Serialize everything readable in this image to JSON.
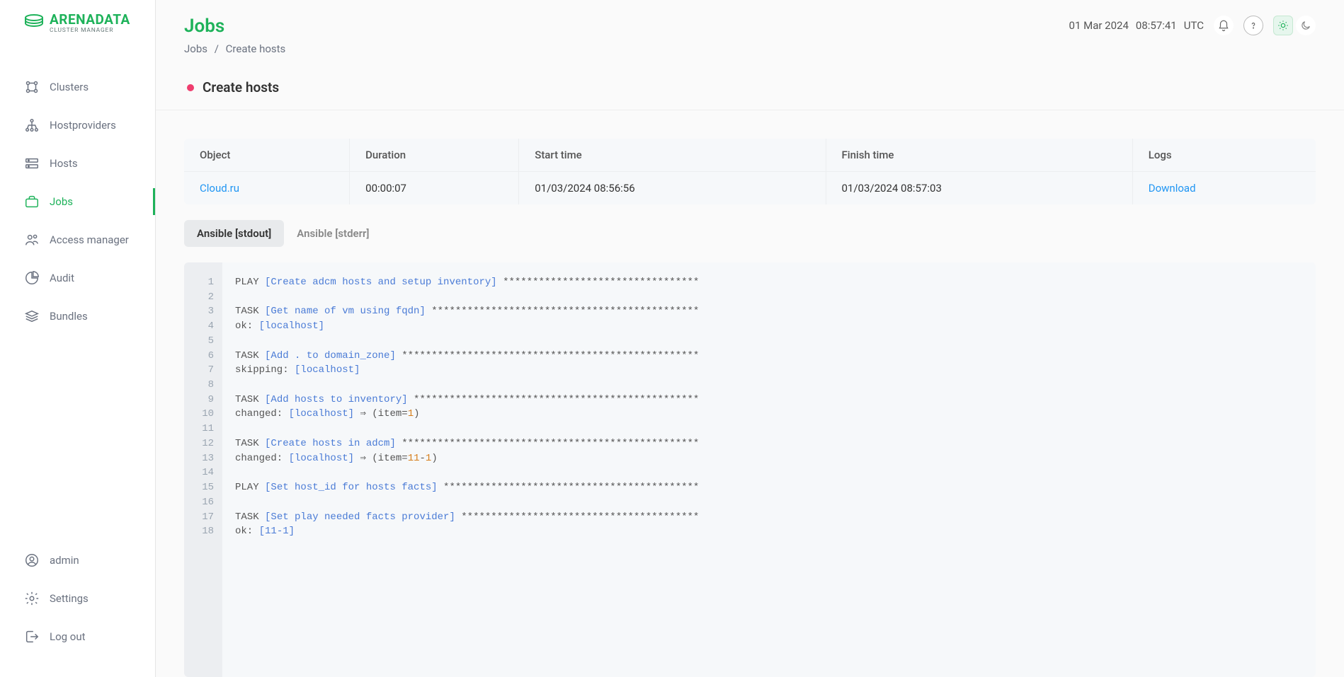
{
  "brand": {
    "name": "ARENADATA",
    "tagline": "CLUSTER MANAGER"
  },
  "sidebar": {
    "items": [
      {
        "key": "clusters",
        "label": "Clusters"
      },
      {
        "key": "hostproviders",
        "label": "Hostproviders"
      },
      {
        "key": "hosts",
        "label": "Hosts"
      },
      {
        "key": "jobs",
        "label": "Jobs"
      },
      {
        "key": "access",
        "label": "Access manager"
      },
      {
        "key": "audit",
        "label": "Audit"
      },
      {
        "key": "bundles",
        "label": "Bundles"
      }
    ],
    "bottom": [
      {
        "key": "admin",
        "label": "admin"
      },
      {
        "key": "settings",
        "label": "Settings"
      },
      {
        "key": "logout",
        "label": "Log out"
      }
    ]
  },
  "header": {
    "title": "Jobs",
    "breadcrumbs": [
      "Jobs",
      "Create hosts"
    ],
    "date": "01 Mar 2024",
    "time": "08:57:41",
    "tz": "UTC"
  },
  "job": {
    "name": "Create hosts",
    "status_color": "#ef3d6e"
  },
  "table": {
    "columns": [
      "Object",
      "Duration",
      "Start time",
      "Finish time",
      "Logs"
    ],
    "row": {
      "object": "Cloud.ru",
      "duration": "00:00:07",
      "start": "01/03/2024 08:56:56",
      "finish": "01/03/2024 08:57:03",
      "logs": "Download"
    }
  },
  "tabs": {
    "items": [
      "Ansible [stdout]",
      "Ansible [stderr]"
    ],
    "active": 0
  },
  "log": {
    "lines": [
      {
        "t": "PLAY ",
        "b": "[Create adcm hosts and setup inventory]",
        "a": " *********************************"
      },
      {
        "t": ""
      },
      {
        "t": "TASK ",
        "b": "[Get name of vm using fqdn]",
        "a": " *********************************************"
      },
      {
        "t": "ok: ",
        "b": "[localhost]"
      },
      {
        "t": ""
      },
      {
        "t": "TASK ",
        "b": "[Add . to domain_zone]",
        "a": " **************************************************"
      },
      {
        "t": "skipping: ",
        "b": "[localhost]"
      },
      {
        "t": ""
      },
      {
        "t": "TASK ",
        "b": "[Add hosts to inventory]",
        "a": " ************************************************"
      },
      {
        "t": "changed: ",
        "b": "[localhost]",
        "a2": " ⇒ (item=",
        "o": "1",
        "a3": ")"
      },
      {
        "t": ""
      },
      {
        "t": "TASK ",
        "b": "[Create hosts in adcm]",
        "a": " **************************************************"
      },
      {
        "t": "changed: ",
        "b": "[localhost]",
        "a2": " ⇒ (item=",
        "o": "11",
        "a3_mid": "-",
        "o2": "1",
        "a3": ")"
      },
      {
        "t": ""
      },
      {
        "t": "PLAY ",
        "b": "[Set host_id for hosts facts]",
        "a": " *******************************************"
      },
      {
        "t": ""
      },
      {
        "t": "TASK ",
        "b": "[Set play needed facts provider]",
        "a": " ****************************************"
      },
      {
        "t": "ok: ",
        "b": "[11-1]"
      }
    ]
  }
}
